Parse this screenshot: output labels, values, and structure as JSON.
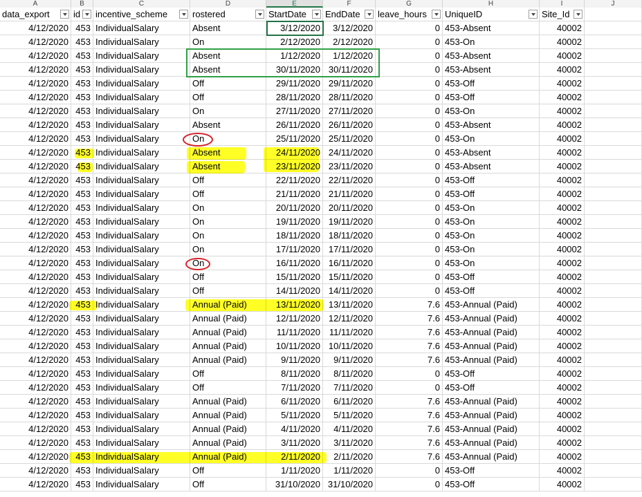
{
  "columns": [
    "A",
    "B",
    "C",
    "D",
    "E",
    "F",
    "G",
    "H",
    "I",
    "J"
  ],
  "header": [
    "data_export",
    "id",
    "incentive_scheme",
    "rostered",
    "StartDate",
    "EndDate",
    "leave_hours",
    "UniqueID",
    "Site_Id",
    ""
  ],
  "rows": [
    [
      "4/12/2020",
      "453",
      "IndividualSalary",
      "Absent",
      "3/12/2020",
      "3/12/2020",
      "0",
      "453-Absent",
      "40002"
    ],
    [
      "4/12/2020",
      "453",
      "IndividualSalary",
      "On",
      "2/12/2020",
      "2/12/2020",
      "0",
      "453-On",
      "40002"
    ],
    [
      "4/12/2020",
      "453",
      "IndividualSalary",
      "Absent",
      "1/12/2020",
      "1/12/2020",
      "0",
      "453-Absent",
      "40002"
    ],
    [
      "4/12/2020",
      "453",
      "IndividualSalary",
      "Absent",
      "30/11/2020",
      "30/11/2020",
      "0",
      "453-Absent",
      "40002"
    ],
    [
      "4/12/2020",
      "453",
      "IndividualSalary",
      "Off",
      "29/11/2020",
      "29/11/2020",
      "0",
      "453-Off",
      "40002"
    ],
    [
      "4/12/2020",
      "453",
      "IndividualSalary",
      "Off",
      "28/11/2020",
      "28/11/2020",
      "0",
      "453-Off",
      "40002"
    ],
    [
      "4/12/2020",
      "453",
      "IndividualSalary",
      "On",
      "27/11/2020",
      "27/11/2020",
      "0",
      "453-On",
      "40002"
    ],
    [
      "4/12/2020",
      "453",
      "IndividualSalary",
      "Absent",
      "26/11/2020",
      "26/11/2020",
      "0",
      "453-Absent",
      "40002"
    ],
    [
      "4/12/2020",
      "453",
      "IndividualSalary",
      "On",
      "25/11/2020",
      "25/11/2020",
      "0",
      "453-On",
      "40002"
    ],
    [
      "4/12/2020",
      "453",
      "IndividualSalary",
      "Absent",
      "24/11/2020",
      "24/11/2020",
      "0",
      "453-Absent",
      "40002"
    ],
    [
      "4/12/2020",
      "453",
      "IndividualSalary",
      "Absent",
      "23/11/2020",
      "23/11/2020",
      "0",
      "453-Absent",
      "40002"
    ],
    [
      "4/12/2020",
      "453",
      "IndividualSalary",
      "Off",
      "22/11/2020",
      "22/11/2020",
      "0",
      "453-Off",
      "40002"
    ],
    [
      "4/12/2020",
      "453",
      "IndividualSalary",
      "Off",
      "21/11/2020",
      "21/11/2020",
      "0",
      "453-Off",
      "40002"
    ],
    [
      "4/12/2020",
      "453",
      "IndividualSalary",
      "On",
      "20/11/2020",
      "20/11/2020",
      "0",
      "453-On",
      "40002"
    ],
    [
      "4/12/2020",
      "453",
      "IndividualSalary",
      "On",
      "19/11/2020",
      "19/11/2020",
      "0",
      "453-On",
      "40002"
    ],
    [
      "4/12/2020",
      "453",
      "IndividualSalary",
      "On",
      "18/11/2020",
      "18/11/2020",
      "0",
      "453-On",
      "40002"
    ],
    [
      "4/12/2020",
      "453",
      "IndividualSalary",
      "On",
      "17/11/2020",
      "17/11/2020",
      "0",
      "453-On",
      "40002"
    ],
    [
      "4/12/2020",
      "453",
      "IndividualSalary",
      "On",
      "16/11/2020",
      "16/11/2020",
      "0",
      "453-On",
      "40002"
    ],
    [
      "4/12/2020",
      "453",
      "IndividualSalary",
      "Off",
      "15/11/2020",
      "15/11/2020",
      "0",
      "453-Off",
      "40002"
    ],
    [
      "4/12/2020",
      "453",
      "IndividualSalary",
      "Off",
      "14/11/2020",
      "14/11/2020",
      "0",
      "453-Off",
      "40002"
    ],
    [
      "4/12/2020",
      "453",
      "IndividualSalary",
      "Annual (Paid)",
      "13/11/2020",
      "13/11/2020",
      "7.6",
      "453-Annual (Paid)",
      "40002"
    ],
    [
      "4/12/2020",
      "453",
      "IndividualSalary",
      "Annual (Paid)",
      "12/11/2020",
      "12/11/2020",
      "7.6",
      "453-Annual (Paid)",
      "40002"
    ],
    [
      "4/12/2020",
      "453",
      "IndividualSalary",
      "Annual (Paid)",
      "11/11/2020",
      "11/11/2020",
      "7.6",
      "453-Annual (Paid)",
      "40002"
    ],
    [
      "4/12/2020",
      "453",
      "IndividualSalary",
      "Annual (Paid)",
      "10/11/2020",
      "10/11/2020",
      "7.6",
      "453-Annual (Paid)",
      "40002"
    ],
    [
      "4/12/2020",
      "453",
      "IndividualSalary",
      "Annual (Paid)",
      "9/11/2020",
      "9/11/2020",
      "7.6",
      "453-Annual (Paid)",
      "40002"
    ],
    [
      "4/12/2020",
      "453",
      "IndividualSalary",
      "Off",
      "8/11/2020",
      "8/11/2020",
      "0",
      "453-Off",
      "40002"
    ],
    [
      "4/12/2020",
      "453",
      "IndividualSalary",
      "Off",
      "7/11/2020",
      "7/11/2020",
      "0",
      "453-Off",
      "40002"
    ],
    [
      "4/12/2020",
      "453",
      "IndividualSalary",
      "Annual (Paid)",
      "6/11/2020",
      "6/11/2020",
      "7.6",
      "453-Annual (Paid)",
      "40002"
    ],
    [
      "4/12/2020",
      "453",
      "IndividualSalary",
      "Annual (Paid)",
      "5/11/2020",
      "5/11/2020",
      "7.6",
      "453-Annual (Paid)",
      "40002"
    ],
    [
      "4/12/2020",
      "453",
      "IndividualSalary",
      "Annual (Paid)",
      "4/11/2020",
      "4/11/2020",
      "7.6",
      "453-Annual (Paid)",
      "40002"
    ],
    [
      "4/12/2020",
      "453",
      "IndividualSalary",
      "Annual (Paid)",
      "3/11/2020",
      "3/11/2020",
      "7.6",
      "453-Annual (Paid)",
      "40002"
    ],
    [
      "4/12/2020",
      "453",
      "IndividualSalary",
      "Annual (Paid)",
      "2/11/2020",
      "2/11/2020",
      "7.6",
      "453-Annual (Paid)",
      "40002"
    ],
    [
      "4/12/2020",
      "453",
      "IndividualSalary",
      "Off",
      "1/11/2020",
      "1/11/2020",
      "0",
      "453-Off",
      "40002"
    ],
    [
      "4/12/2020",
      "453",
      "IndividualSalary",
      "Off",
      "31/10/2020",
      "31/10/2020",
      "0",
      "453-Off",
      "40002"
    ]
  ],
  "selected_column": "E",
  "annotation_colors": {
    "highlight": "#ffff00",
    "circle": "#d6222a",
    "box": "#2ea043",
    "selection": "#217346"
  }
}
